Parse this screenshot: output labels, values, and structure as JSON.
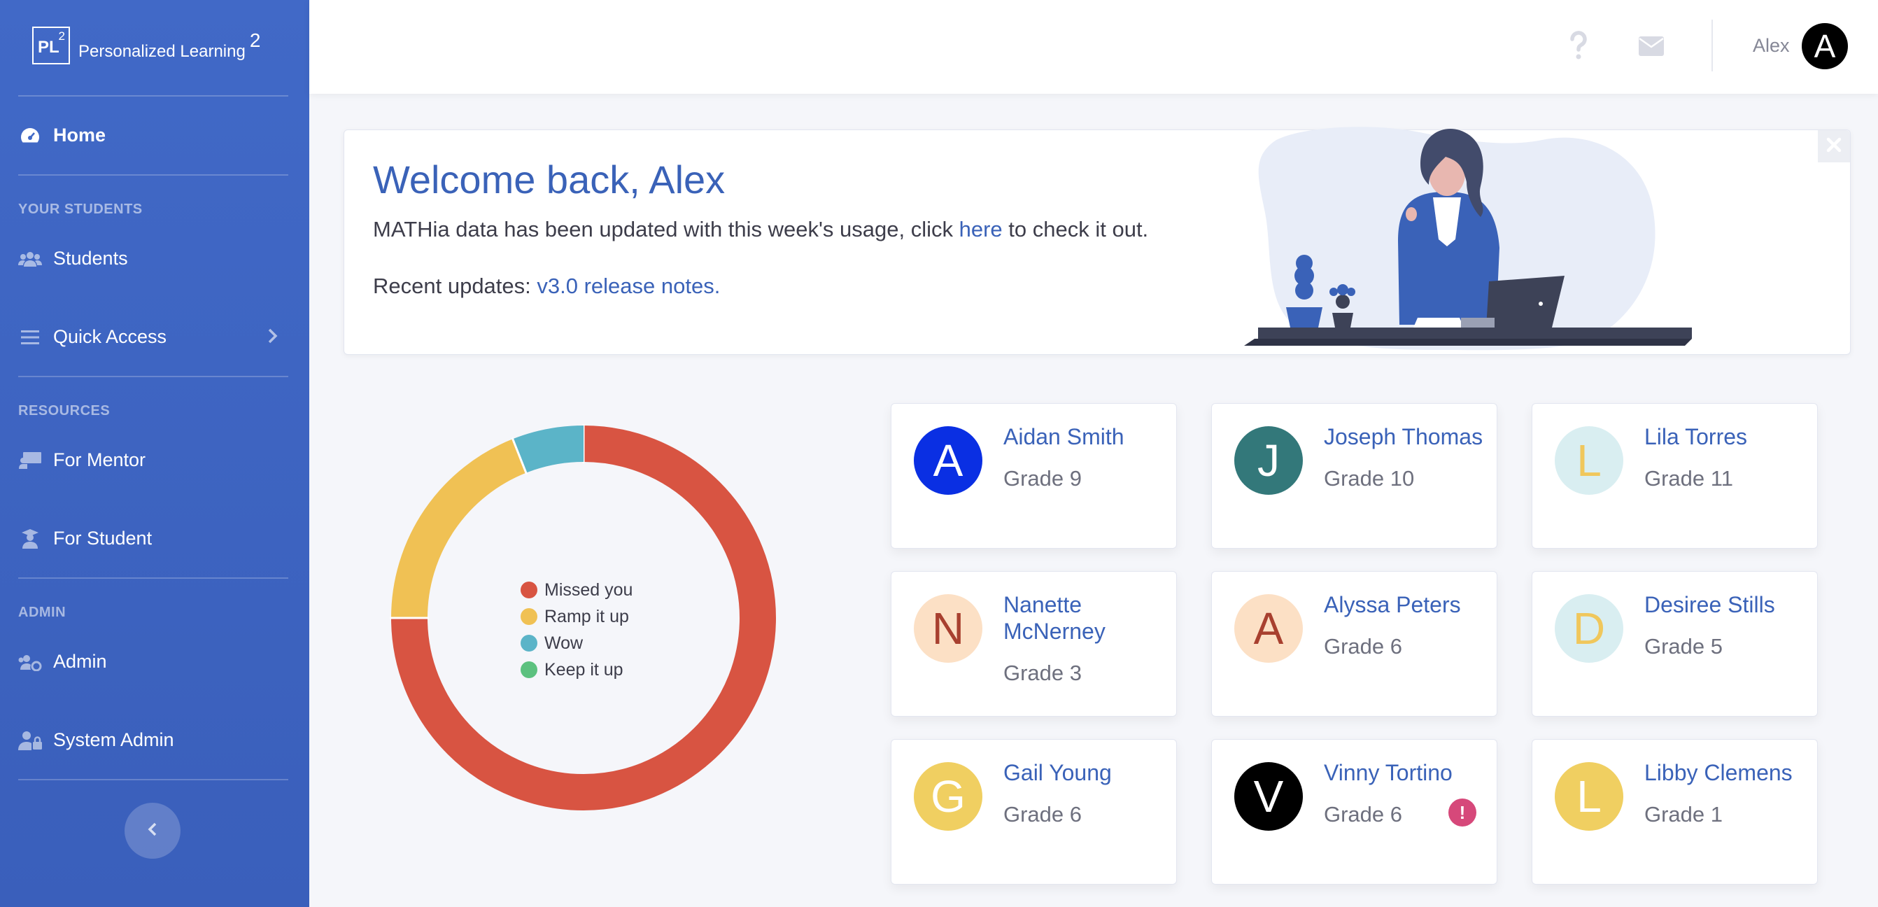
{
  "brand": {
    "logo_text": "PL",
    "logo_sup": "2",
    "name": "Personalized Learning",
    "name_sup": "2"
  },
  "sidebar": {
    "home": "Home",
    "sections": {
      "students": "YOUR STUDENTS",
      "resources": "RESOURCES",
      "admin": "ADMIN"
    },
    "items": {
      "students": "Students",
      "quick_access": "Quick Access",
      "for_mentor": "For Mentor",
      "for_student": "For Student",
      "admin": "Admin",
      "system_admin": "System Admin"
    }
  },
  "topbar": {
    "user_name": "Alex",
    "avatar_letter": "A"
  },
  "welcome": {
    "title": "Welcome back, Alex",
    "line1_pre": "MATHia data has been updated with this week's usage, click ",
    "line1_link": "here",
    "line1_post": " to check it out.",
    "line2_pre": "Recent updates: ",
    "line2_link": "v3.0 release notes."
  },
  "chart_data": {
    "type": "pie",
    "title": "",
    "categories": [
      "Missed you",
      "Ramp it up",
      "Wow",
      "Keep it up"
    ],
    "values": [
      75,
      19,
      6,
      0
    ],
    "colors": [
      "#d85442",
      "#f0c154",
      "#5bb4c8",
      "#5cc17f"
    ],
    "legend_position": "center"
  },
  "students": [
    {
      "initial": "A",
      "name": "Aidan Smith",
      "grade": "Grade 9",
      "bg": "#0a2fe3",
      "fg": "#ffffff",
      "alert": ""
    },
    {
      "initial": "J",
      "name": "Joseph Thomas",
      "grade": "Grade 10",
      "bg": "#33787a",
      "fg": "#ffffff",
      "alert": ""
    },
    {
      "initial": "L",
      "name": "Lila Torres",
      "grade": "Grade 11",
      "bg": "#d9eef1",
      "fg": "#f0c75c",
      "alert": ""
    },
    {
      "initial": "N",
      "name": "Nanette McNerney",
      "grade": "Grade 3",
      "bg": "#fce0c5",
      "fg": "#a8402f",
      "alert": ""
    },
    {
      "initial": "A",
      "name": "Alyssa Peters",
      "grade": "Grade 6",
      "bg": "#fce0c5",
      "fg": "#a8402f",
      "alert": ""
    },
    {
      "initial": "D",
      "name": "Desiree Stills",
      "grade": "Grade 5",
      "bg": "#d9eef1",
      "fg": "#f0c75c",
      "alert": ""
    },
    {
      "initial": "G",
      "name": "Gail Young",
      "grade": "Grade 6",
      "bg": "#f0cf61",
      "fg": "#ffffff",
      "alert": ""
    },
    {
      "initial": "V",
      "name": "Vinny Tortino",
      "grade": "Grade 6",
      "bg": "#000000",
      "fg": "#ffffff",
      "alert": "!"
    },
    {
      "initial": "L",
      "name": "Libby Clemens",
      "grade": "Grade 1",
      "bg": "#f0cf61",
      "fg": "#ffffff",
      "alert": ""
    }
  ]
}
